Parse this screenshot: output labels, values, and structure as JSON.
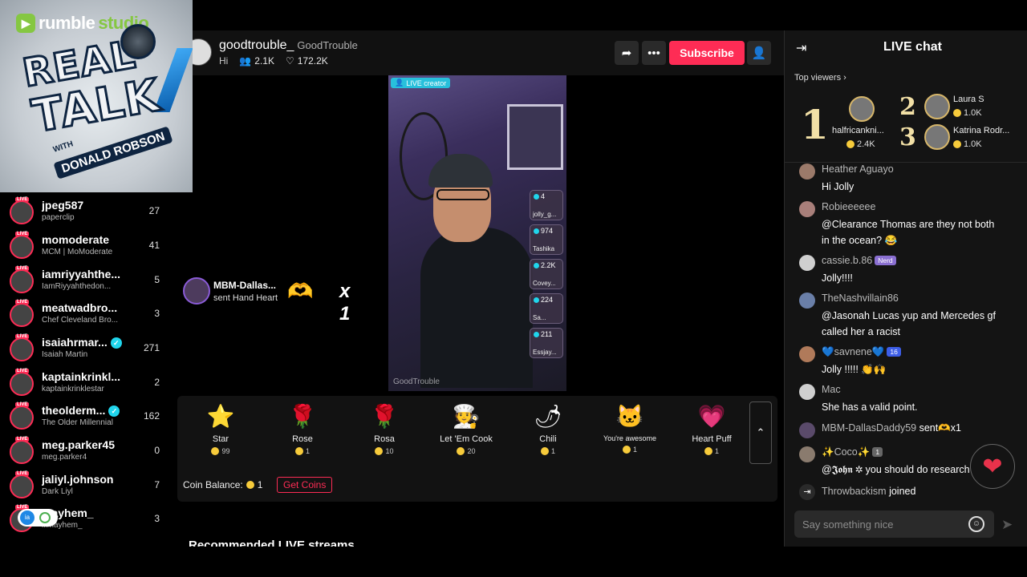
{
  "overlay": {
    "brand": "rumble",
    "brand_accent": "studio",
    "show_line1": "REAL",
    "show_line2": "TALK",
    "show_with": "WITH",
    "show_host": "DONALD ROBSON"
  },
  "sidebar": {
    "items": [
      {
        "name": "jpeg587",
        "sub": "paperclip",
        "count": "27",
        "verified": false
      },
      {
        "name": "momoderate",
        "sub": "MCM | MoModerate",
        "count": "41",
        "verified": false
      },
      {
        "name": "iamriyyahthe...",
        "sub": "IamRiyyahthedon...",
        "count": "5",
        "verified": false
      },
      {
        "name": "meatwadbro...",
        "sub": "Chef Cleveland Bro...",
        "count": "3",
        "verified": false
      },
      {
        "name": "isaiahrmar...",
        "sub": "Isaiah Martin",
        "count": "271",
        "verified": true
      },
      {
        "name": "kaptainkrinkl...",
        "sub": "kaptainkrinklestar",
        "count": "2",
        "verified": false
      },
      {
        "name": "theolderm...",
        "sub": "The Older Millennial",
        "count": "162",
        "verified": true
      },
      {
        "name": "meg.parker45",
        "sub": "meg.parker4",
        "count": "0",
        "verified": false
      },
      {
        "name": "jaliyl.johnson",
        "sub": "Dark Liyl",
        "count": "7",
        "verified": false
      },
      {
        "name": "mayhem_",
        "sub": "illmayhem_",
        "count": "3",
        "verified": false
      }
    ],
    "live_badge": "LIVE"
  },
  "stream": {
    "host_username": "goodtrouble_",
    "host_nickname": "GoodTrouble",
    "host_bio": "Hi",
    "viewers": "2.1K",
    "likes": "172.2K",
    "subscribe_label": "Subscribe",
    "live_creator_label": "LIVE creator",
    "watermark": "GoodTrouble",
    "guests": [
      {
        "count": "4",
        "name": "jolly_g..."
      },
      {
        "count": "974",
        "name": "Tashika"
      },
      {
        "count": "2.2K",
        "name": "Covey..."
      },
      {
        "count": "224",
        "name": "Sa..."
      },
      {
        "count": "211",
        "name": "Essjay..."
      }
    ]
  },
  "gift_notice": {
    "name": "MBM-Dallas...",
    "action": "sent Hand Heart",
    "multiplier": "x 1"
  },
  "gifts": [
    {
      "name": "Star",
      "price": "99",
      "icon": "star-icon",
      "glyph": "⭐"
    },
    {
      "name": "Rose",
      "price": "1",
      "icon": "rose-icon",
      "glyph": "🌹"
    },
    {
      "name": "Rosa",
      "price": "10",
      "icon": "rosa-icon",
      "glyph": "🌹"
    },
    {
      "name": "Let 'Em Cook",
      "price": "20",
      "icon": "cook-icon",
      "glyph": "🧑‍🍳"
    },
    {
      "name": "Chili",
      "price": "1",
      "icon": "chili-icon",
      "glyph": "🌶"
    },
    {
      "name": "You're awesome",
      "price": "1",
      "icon": "cat-icon",
      "glyph": "🐱"
    },
    {
      "name": "Heart Puff",
      "price": "1",
      "icon": "heart-puff-icon",
      "glyph": "💗"
    }
  ],
  "wallet": {
    "balance_label": "Coin Balance:",
    "balance": "1",
    "get_coins": "Get Coins"
  },
  "recommended_title": "Recommended LIVE streams",
  "chat": {
    "title": "LIVE chat",
    "top_viewers_label": "Top viewers",
    "top_viewers": [
      {
        "rank": "1",
        "name": "halfricankni...",
        "coins": "2.4K"
      },
      {
        "rank": "2",
        "name": "Laura S",
        "coins": "1.0K"
      },
      {
        "rank": "3",
        "name": "Katrina Rodr...",
        "coins": "1.0K"
      }
    ],
    "messages": [
      {
        "user": "Heather Aguayo",
        "text": "Hi Jolly"
      },
      {
        "user": "Robieeeeee",
        "text": "@Clearance Thomas are they not both in the ocean? 😂"
      },
      {
        "user": "cassie.b.86",
        "badge": "Nerd",
        "text": "Jolly!!!!"
      },
      {
        "user": "TheNashvillain86",
        "text": "@Jasonah Lucas yup and Mercedes gf called her a racist"
      },
      {
        "user": "💙savnene💙",
        "badge": "16",
        "text": "Jolly !!!!! 👏🙌"
      },
      {
        "user": "Mac",
        "text": "She has a valid point."
      },
      {
        "user": "MBM-DallasDaddy59",
        "text": "sent🫶x1"
      },
      {
        "user": "✨Coco✨",
        "badge": "1",
        "text": "@𝕵𝖔𝖍𝖓 ✲ you should do research"
      }
    ],
    "join_event": {
      "user": "Throwbackism",
      "text": "joined"
    },
    "input_placeholder": "Say something nice"
  },
  "colors": {
    "accent": "#fe2c55",
    "verified": "#20d5ec",
    "coin": "#f7cb3b",
    "rumble_green": "#85c742"
  }
}
